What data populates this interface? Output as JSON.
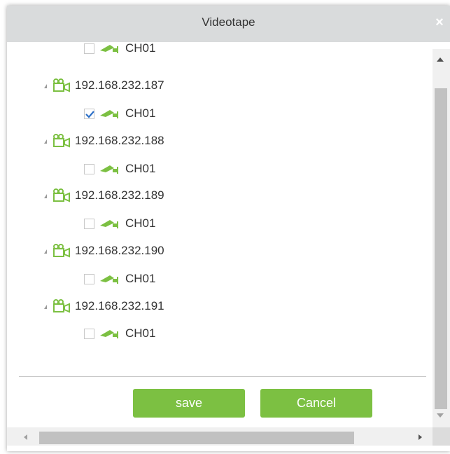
{
  "dialog": {
    "title": "Videotape",
    "close_symbol": "×",
    "accent_color": "#7cc042",
    "titlebar_color": "#d9dbdc"
  },
  "tree": {
    "partial_channel": {
      "label": "CH01",
      "checked": false
    },
    "devices": [
      {
        "ip": "192.168.232.187",
        "icon": "network-camera-icon",
        "channel": {
          "label": "CH01",
          "checked": true
        }
      },
      {
        "ip": "192.168.232.188",
        "icon": "network-camera-icon",
        "channel": {
          "label": "CH01",
          "checked": false
        }
      },
      {
        "ip": "192.168.232.189",
        "icon": "network-camera-icon",
        "channel": {
          "label": "CH01",
          "checked": false
        }
      },
      {
        "ip": "192.168.232.190",
        "icon": "network-camera-icon",
        "channel": {
          "label": "CH01",
          "checked": false
        }
      },
      {
        "ip": "192.168.232.191",
        "icon": "network-camera-icon",
        "channel": {
          "label": "CH01",
          "checked": false
        }
      }
    ]
  },
  "buttons": {
    "save_label": "save",
    "cancel_label": "Cancel"
  }
}
